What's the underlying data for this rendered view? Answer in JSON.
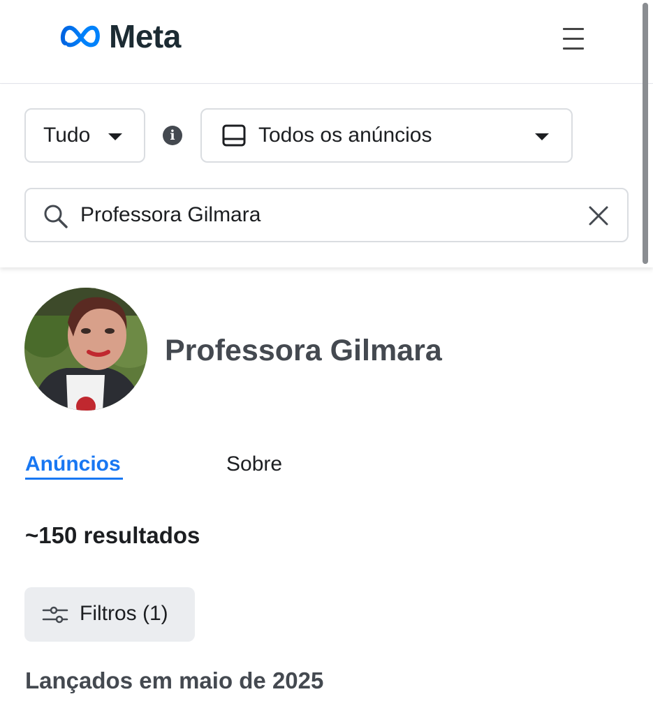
{
  "header": {
    "logo_text": "Meta",
    "menu_icon": "hamburger-menu-icon"
  },
  "search": {
    "category_select": {
      "value": "Tudo"
    },
    "info_icon": "info-circle-icon",
    "ad_type_select": {
      "value": "Todos os anúncios",
      "icon": "device-icon"
    },
    "query": "Professora Gilmara",
    "search_icon": "search-icon",
    "clear_icon": "close-icon"
  },
  "profile": {
    "name": "Professora Gilmara",
    "avatar": "profile-photo"
  },
  "tabs": [
    {
      "label": "Anúncios",
      "active": true
    },
    {
      "label": "Sobre",
      "active": false
    }
  ],
  "results": {
    "count_text": "~150 resultados"
  },
  "filters": {
    "label": "Filtros (1)",
    "icon": "sliders-icon"
  },
  "section": {
    "heading": "Lançados em maio de 2025"
  },
  "colors": {
    "accent": "#1877f2",
    "text": "#1c1e21",
    "secondary_text": "#444950",
    "border": "#dadde1",
    "button_bg": "#ebedf0"
  }
}
